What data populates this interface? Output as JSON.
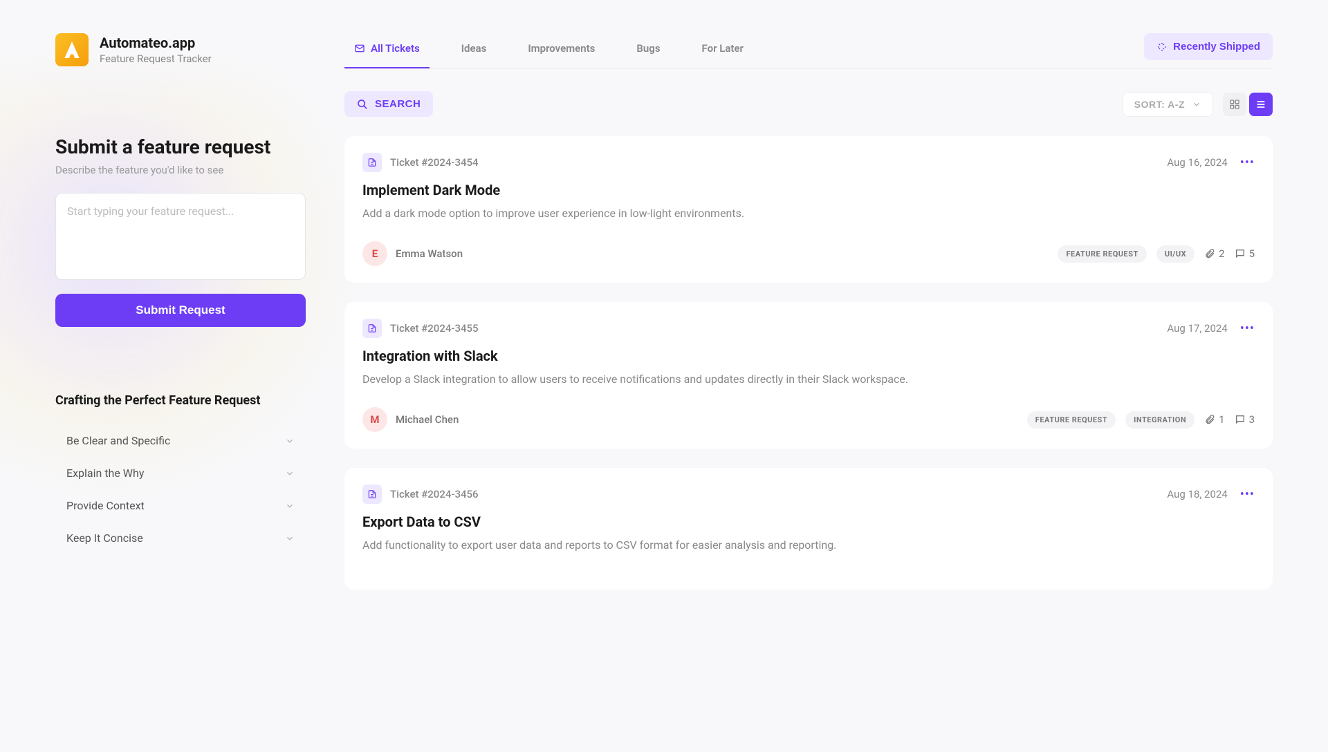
{
  "logo": {
    "title": "Automateo.app",
    "subtitle": "Feature Request Tracker"
  },
  "form": {
    "title": "Submit a feature request",
    "subtitle": "Describe the feature you'd like to see",
    "placeholder": "Start typing your feature request...",
    "submit": "Submit Request"
  },
  "tips": {
    "title": "Crafting the Perfect Feature Request",
    "items": [
      "Be Clear and Specific",
      "Explain the Why",
      "Provide Context",
      "Keep It Concise"
    ]
  },
  "tabs": [
    "All Tickets",
    "Ideas",
    "Improvements",
    "Bugs",
    "For Later"
  ],
  "shipped": "Recently Shipped",
  "search": "SEARCH",
  "sort": "SORT: A-Z",
  "tickets": [
    {
      "id": "Ticket #2024-3454",
      "date": "Aug 16, 2024",
      "title": "Implement Dark Mode",
      "desc": "Add a dark mode option to improve user experience in low-light environments.",
      "author": "Emma Watson",
      "initial": "E",
      "avatarBg": "#fde6e6",
      "avatarFg": "#d94a4a",
      "tags": [
        "FEATURE REQUEST",
        "UI/UX"
      ],
      "attachments": "2",
      "comments": "5"
    },
    {
      "id": "Ticket #2024-3455",
      "date": "Aug 17, 2024",
      "title": "Integration with Slack",
      "desc": "Develop a Slack integration to allow users to receive notifications and updates directly in their Slack workspace.",
      "author": "Michael Chen",
      "initial": "M",
      "avatarBg": "#fde6e6",
      "avatarFg": "#d94a4a",
      "tags": [
        "FEATURE REQUEST",
        "INTEGRATION"
      ],
      "attachments": "1",
      "comments": "3"
    },
    {
      "id": "Ticket #2024-3456",
      "date": "Aug 18, 2024",
      "title": "Export Data to CSV",
      "desc": "Add functionality to export user data and reports to CSV format for easier analysis and reporting.",
      "author": "",
      "initial": "",
      "avatarBg": "",
      "avatarFg": "",
      "tags": [],
      "attachments": "",
      "comments": ""
    }
  ]
}
